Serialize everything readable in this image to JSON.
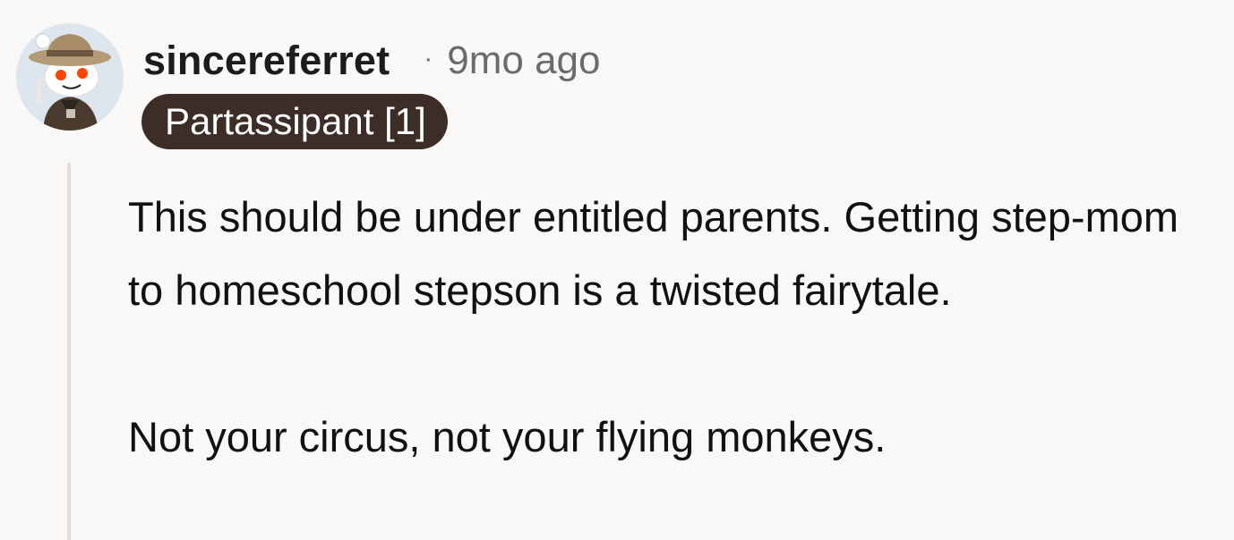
{
  "comment": {
    "username": "sincereferret",
    "separator": "·",
    "timestamp": "9mo ago",
    "flair": "Partassipant [1]",
    "paragraphs": [
      "This should be under entitled parents. Getting step-mom to homeschool stepson is a twisted fairytale.",
      "Not your circus, not your flying monkeys."
    ]
  },
  "colors": {
    "background": "#faf8f7",
    "flair_background": "#3c2e27",
    "flair_text": "#ffffff",
    "timestamp": "#6b6b6b",
    "thread_line": "#e3dedb"
  },
  "icons": {
    "avatar": "snoo-avatar-with-safari-hat"
  }
}
